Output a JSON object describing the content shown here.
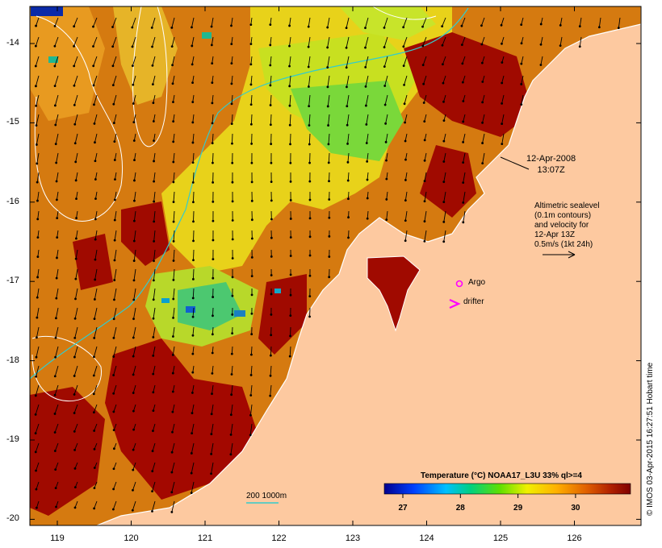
{
  "map": {
    "lon_ticks": [
      "119",
      "120",
      "121",
      "122",
      "123",
      "124",
      "125",
      "126"
    ],
    "lat_ticks": [
      "-14",
      "-15",
      "-16",
      "-17",
      "-18",
      "-19",
      "-20"
    ],
    "date_line1": "12-Apr-2008",
    "date_line2": "13:07Z",
    "notes": [
      "Altimetric sealevel",
      "(0.1m contours)",
      "and velocity for",
      "12-Apr 13Z",
      "0.5m/s (1kt 24h)"
    ],
    "argo_label": "Argo",
    "drifter_label": "drifter",
    "isobath_label": "200  1000m",
    "colorbar_title": "Temperature (°C) NOAA17_L3U 33% ql>=4",
    "colorbar_ticks": [
      "27",
      "28",
      "29",
      "30"
    ],
    "credit": "© IMOS 03-Apr-2015 16:27:51 Hobart time",
    "colors": {
      "land": "#fdc9a0",
      "warm": "#960000",
      "isobath": "#33cccc",
      "argo": "#ff00ff",
      "drifter": "#ff00ff"
    }
  }
}
